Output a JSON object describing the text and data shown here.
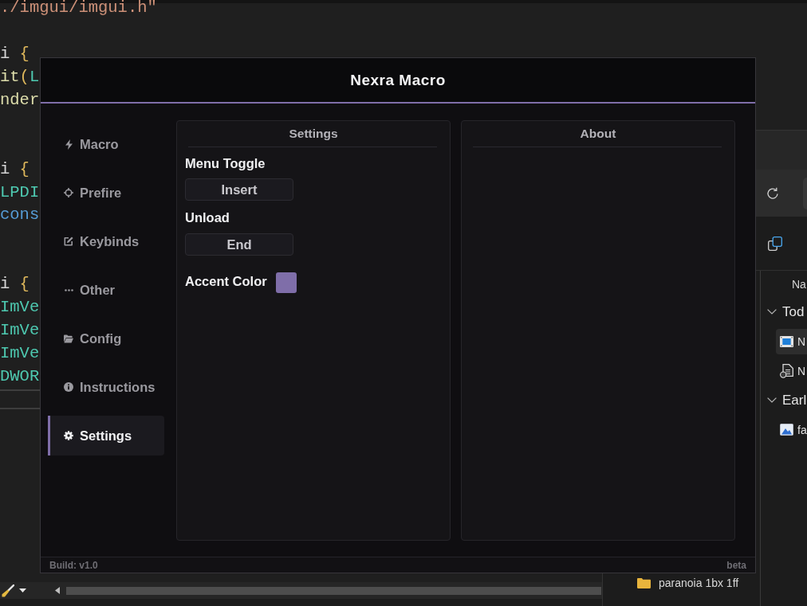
{
  "code_editor": {
    "blocks": [
      {
        "lines": [
          {
            "tokens": [
              {
                "text": "./imgui/imgui.h\"",
                "kind": "string"
              }
            ]
          }
        ]
      },
      {
        "lines": [
          {
            "tokens": [
              {
                "text": "i ",
                "kind": "plain"
              },
              {
                "text": "{",
                "kind": "bracket"
              }
            ]
          },
          {
            "tokens": [
              {
                "text": "it",
                "kind": "function"
              },
              {
                "text": "(",
                "kind": "bracket"
              },
              {
                "text": "L",
                "kind": "type"
              }
            ]
          },
          {
            "tokens": [
              {
                "text": "nder",
                "kind": "function"
              }
            ]
          }
        ]
      },
      {
        "lines": [
          {
            "tokens": [
              {
                "text": "i ",
                "kind": "plain"
              },
              {
                "text": "{",
                "kind": "bracket"
              }
            ]
          },
          {
            "tokens": [
              {
                "text": "LPDI",
                "kind": "type"
              }
            ]
          },
          {
            "tokens": [
              {
                "text": "cons",
                "kind": "keyword"
              }
            ]
          }
        ]
      },
      {
        "lines": [
          {
            "tokens": [
              {
                "text": "i ",
                "kind": "plain"
              },
              {
                "text": "{",
                "kind": "bracket"
              }
            ]
          },
          {
            "tokens": [
              {
                "text": "ImVe",
                "kind": "type"
              }
            ]
          },
          {
            "tokens": [
              {
                "text": "ImVe",
                "kind": "type"
              }
            ]
          },
          {
            "tokens": [
              {
                "text": "ImVe",
                "kind": "type"
              }
            ]
          },
          {
            "tokens": [
              {
                "text": "DWOR",
                "kind": "type"
              }
            ]
          }
        ]
      }
    ]
  },
  "file_explorer": {
    "column_header": "Na",
    "groups": [
      {
        "label": "Tod",
        "expanded": true,
        "children": [
          {
            "name": "N",
            "kind": "video",
            "selected": true
          },
          {
            "name": "N",
            "kind": "document",
            "selected": false
          }
        ]
      },
      {
        "label": "Earl",
        "expanded": true,
        "children": [
          {
            "name": "fa",
            "kind": "image",
            "selected": false
          }
        ]
      }
    ],
    "nav_pane": [
      {
        "label": "paranoia 1bx 1ff"
      }
    ]
  },
  "macro_window": {
    "title": "Nexra Macro",
    "sidebar": {
      "items": [
        {
          "label": "Macro",
          "selected": false
        },
        {
          "label": "Prefire",
          "selected": false
        },
        {
          "label": "Keybinds",
          "selected": false
        },
        {
          "label": "Other",
          "selected": false
        },
        {
          "label": "Config",
          "selected": false
        },
        {
          "label": "Instructions",
          "selected": false
        },
        {
          "label": "Settings",
          "selected": true
        }
      ]
    },
    "settings_panel": {
      "title": "Settings",
      "keybinds": [
        {
          "label": "Menu Toggle",
          "key": "Insert"
        },
        {
          "label": "Unload",
          "key": "End"
        }
      ],
      "accent_color": {
        "label": "Accent Color",
        "color": "#7f6ea9"
      }
    },
    "about_panel": {
      "title": "About"
    },
    "footer": {
      "build": "Build: v1.0",
      "channel": "beta"
    }
  }
}
